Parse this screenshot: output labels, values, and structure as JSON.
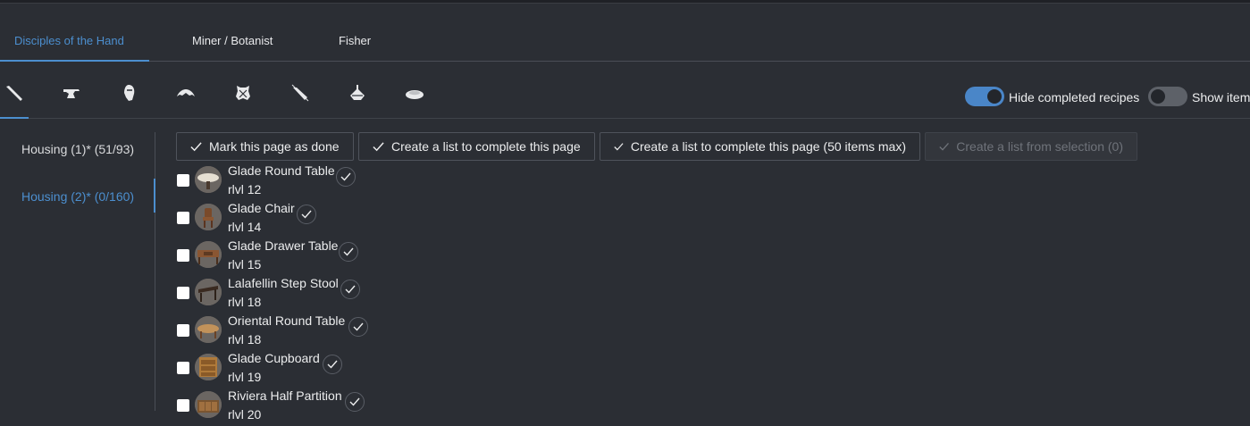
{
  "tabs": [
    {
      "label": "Disciples of the Hand",
      "active": true
    },
    {
      "label": "Miner / Botanist",
      "active": false
    },
    {
      "label": "Fisher",
      "active": false
    }
  ],
  "jobs": [
    {
      "icon": "carpenter-saw-icon",
      "active": true
    },
    {
      "icon": "blacksmith-anvil-icon",
      "active": false
    },
    {
      "icon": "armorer-helm-icon",
      "active": false
    },
    {
      "icon": "goldsmith-circlet-icon",
      "active": false
    },
    {
      "icon": "leatherworker-hide-icon",
      "active": false
    },
    {
      "icon": "weaver-needle-icon",
      "active": false
    },
    {
      "icon": "alchemist-flask-icon",
      "active": false
    },
    {
      "icon": "culinarian-dish-icon",
      "active": false
    }
  ],
  "toggles": {
    "hide_completed": {
      "label": "Hide completed recipes",
      "on": true
    },
    "show_items": {
      "label": "Show item",
      "on": false
    }
  },
  "sidebar": {
    "items": [
      {
        "label": "Housing (1)* (51/93)",
        "active": false
      },
      {
        "label": "Housing (2)* (0/160)",
        "active": true
      }
    ]
  },
  "actions": {
    "mark_done": "Mark this page as done",
    "create_list": "Create a list to complete this page",
    "create_list_50": "Create a list to complete this page (50 items max)",
    "create_from_selection": "Create a list from selection (0)"
  },
  "recipes": [
    {
      "name": "Glade Round Table",
      "level": "rlvl 12",
      "icon": "round-table-icon"
    },
    {
      "name": "Glade Chair",
      "level": "rlvl 14",
      "icon": "chair-icon"
    },
    {
      "name": "Glade Drawer Table",
      "level": "rlvl 15",
      "icon": "drawer-table-icon"
    },
    {
      "name": "Lalafellin Step Stool",
      "level": "rlvl 18",
      "icon": "step-stool-icon"
    },
    {
      "name": "Oriental Round Table",
      "level": "rlvl 18",
      "icon": "oriental-table-icon"
    },
    {
      "name": "Glade Cupboard",
      "level": "rlvl 19",
      "icon": "cupboard-icon"
    },
    {
      "name": "Riviera Half Partition",
      "level": "rlvl 20",
      "icon": "partition-icon"
    }
  ],
  "colors": {
    "background": "#2b2e34",
    "accent": "#4c8fcf",
    "text": "#ecedee",
    "border": "#4f535b"
  }
}
